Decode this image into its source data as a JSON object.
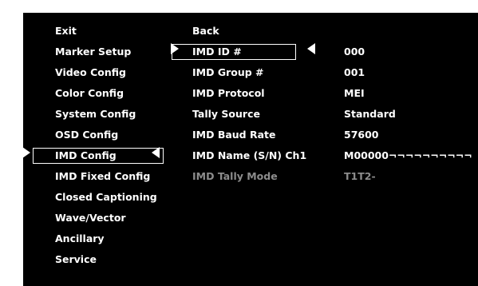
{
  "left_menu": {
    "items": [
      {
        "label": "Exit"
      },
      {
        "label": "Marker Setup"
      },
      {
        "label": "Video Config"
      },
      {
        "label": "Color Config"
      },
      {
        "label": "System Config"
      },
      {
        "label": "OSD Config"
      },
      {
        "label": "IMD Config",
        "selected": true
      },
      {
        "label": "IMD Fixed Config"
      },
      {
        "label": "Closed Captioning"
      },
      {
        "label": "Wave/Vector"
      },
      {
        "label": "Ancillary"
      },
      {
        "label": "Service"
      }
    ]
  },
  "sub_menu": {
    "items": [
      {
        "label": "Back",
        "value": ""
      },
      {
        "label": "IMD ID #",
        "value": "000",
        "selected": true
      },
      {
        "label": "IMD Group #",
        "value": "001"
      },
      {
        "label": "IMD Protocol",
        "value": "MEI"
      },
      {
        "label": "Tally Source",
        "value": "Standard"
      },
      {
        "label": "IMD Baud Rate",
        "value": "57600"
      },
      {
        "label": "IMD Name (S/N) Ch1",
        "value": "M00000¬¬¬¬¬¬¬¬¬¬"
      },
      {
        "label": "IMD Tally Mode",
        "value": "T1T2-",
        "disabled": true
      }
    ]
  },
  "colors": {
    "background": "#000000",
    "text": "#ffffff",
    "disabled_text": "#8c8c8c",
    "page_border": "#ffffff"
  },
  "icons": {
    "selection_left": "triangle-right-icon",
    "selection_right": "triangle-left-icon"
  }
}
